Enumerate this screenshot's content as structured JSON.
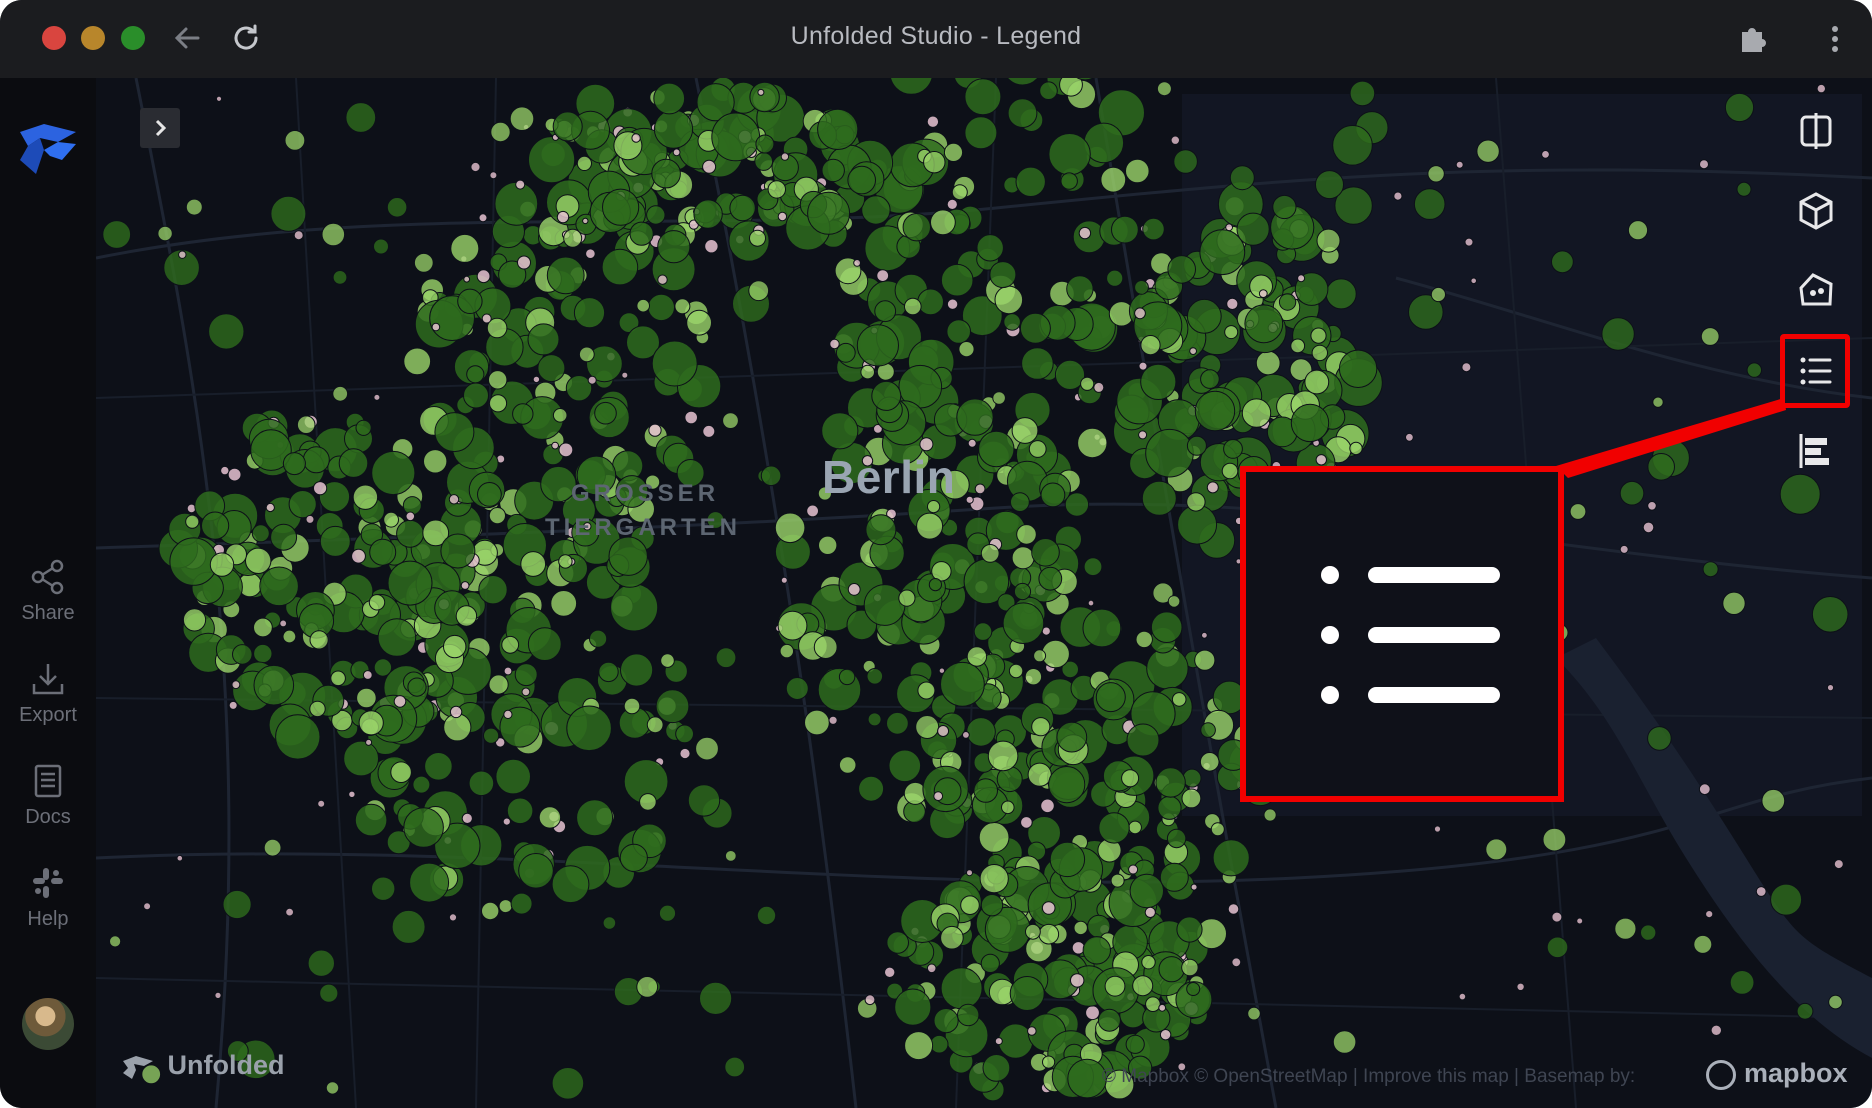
{
  "window": {
    "title": "Unfolded Studio - Legend"
  },
  "sidebar": {
    "items": [
      {
        "label": "Share",
        "icon": "share-icon"
      },
      {
        "label": "Export",
        "icon": "export-icon"
      },
      {
        "label": "Docs",
        "icon": "docs-icon"
      },
      {
        "label": "Help",
        "icon": "help-icon"
      }
    ]
  },
  "map": {
    "city_label": "Berlin",
    "park_label_line1": "GROSSER",
    "park_label_line2": "TIERGARTEN",
    "watermark": "Unfolded",
    "attribution": "© Mapbox © OpenStreetMap | Improve this map | Basemap by:",
    "mapbox_label": "mapbox",
    "colors": {
      "background": "#0d0f16",
      "point_dark": "#2e6b1d",
      "point_light": "#9bd46a",
      "point_pink": "#e8c3d2",
      "highlight": "#f10000"
    }
  },
  "map_controls": [
    {
      "name": "split-map-icon"
    },
    {
      "name": "3d-view-icon"
    },
    {
      "name": "draw-polygon-icon"
    },
    {
      "name": "legend-icon",
      "highlighted": true
    },
    {
      "name": "layer-order-icon"
    }
  ]
}
